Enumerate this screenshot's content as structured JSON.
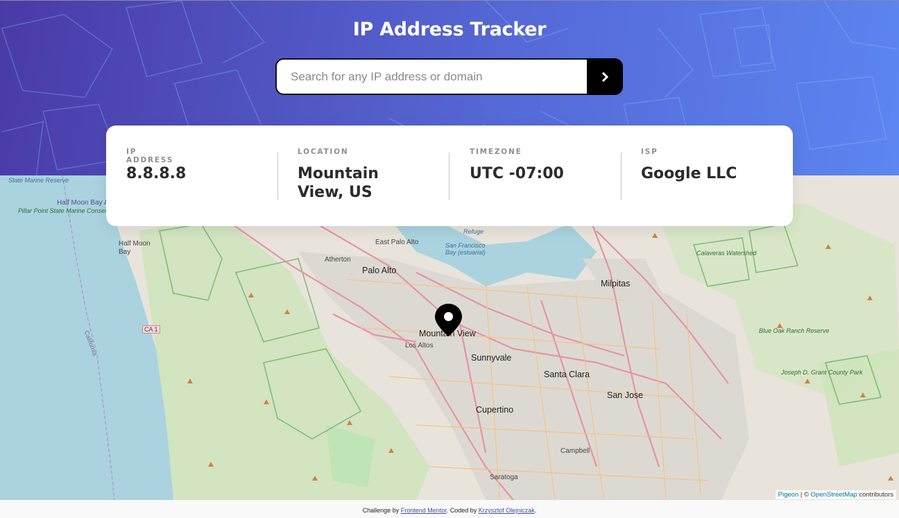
{
  "header": {
    "title": "IP Address Tracker",
    "search": {
      "placeholder": "Search for any IP address or domain",
      "value": ""
    },
    "submit_icon": "chevron-right-icon"
  },
  "info": {
    "ip": {
      "label": "IP ADDRESS",
      "value": "8.8.8.8"
    },
    "location": {
      "label": "LOCATION",
      "value": "Mountain View, US"
    },
    "timezone": {
      "label": "TIMEZONE",
      "value": "UTC -07:00"
    },
    "isp": {
      "label": "ISP",
      "value": "Google LLC"
    }
  },
  "map": {
    "marker_icon": "location-pin-icon",
    "labels": {
      "mountain_view": "Mountain View",
      "palo_alto": "Palo Alto",
      "east_palo_alto": "East Palo Alto",
      "atherton": "Atherton",
      "half_moon_bay": "Half Moon Bay",
      "los_altos": "Los Altos",
      "sunnyvale": "Sunnyvale",
      "santa_clara": "Santa Clara",
      "san_jose": "San Jose",
      "cupertino": "Cupertino",
      "campbell": "Campbell",
      "saratoga": "Saratoga",
      "milpitas": "Milpitas",
      "state_marine": "State Marine Reserve",
      "half_moon_airport": "Half Moon Bay Airport",
      "pillar_point": "Pillar Point State Marine Conservation Area",
      "calaveras": "Calaveras Watershed",
      "blue_oak": "Blue Oak Ranch Reserve",
      "joseph_grant": "Joseph D. Grant County Park",
      "refuge": "Refuge",
      "sf_bay_estuarial": "San Francisco Bay (estuarial)",
      "ca1": "CA 1",
      "california": "California"
    },
    "attribution": {
      "pigeon": "Pigeon",
      "sep": " | © ",
      "osm": "OpenStreetMap",
      "contributors": " contributors"
    }
  },
  "footer": {
    "prefix": "Challenge by ",
    "frontend_mentor": "Frontend Mentor",
    "middle": ". Coded by ",
    "author": "Krzysztof Olejniczak",
    "suffix": "."
  }
}
